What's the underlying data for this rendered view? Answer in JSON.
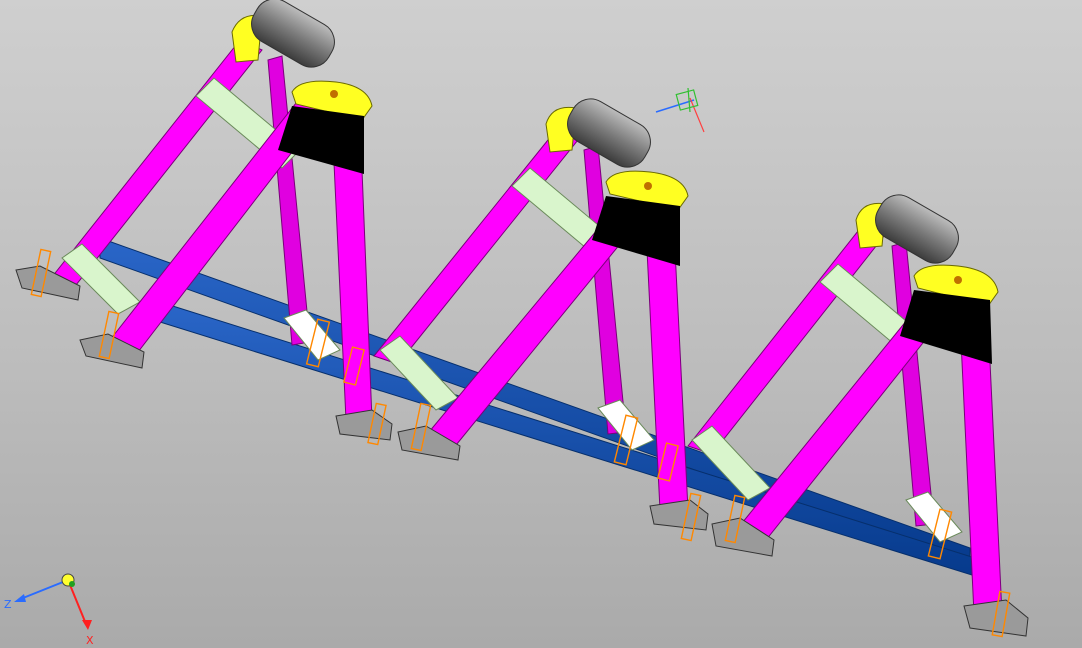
{
  "viewport": {
    "background_top": "#cfcfcf",
    "background_bottom": "#aaaaaa"
  },
  "colors": {
    "frame_leg": "#ff00ff",
    "frame_leg_dark": "#b400b4",
    "brace": "#d9f5cc",
    "rail": "#0a4aa8",
    "rail_dark": "#062f6c",
    "bracket": "#ffff22",
    "roller": "#7a7a7a",
    "plate": "#000000",
    "foot": "#9a9a9a",
    "bolt_outline": "#ff8800"
  },
  "model": {
    "name_icon": "roller-support-assembly",
    "stands": 3
  },
  "triad": {
    "axis_z_label": "Z",
    "axis_x_label": "X"
  }
}
